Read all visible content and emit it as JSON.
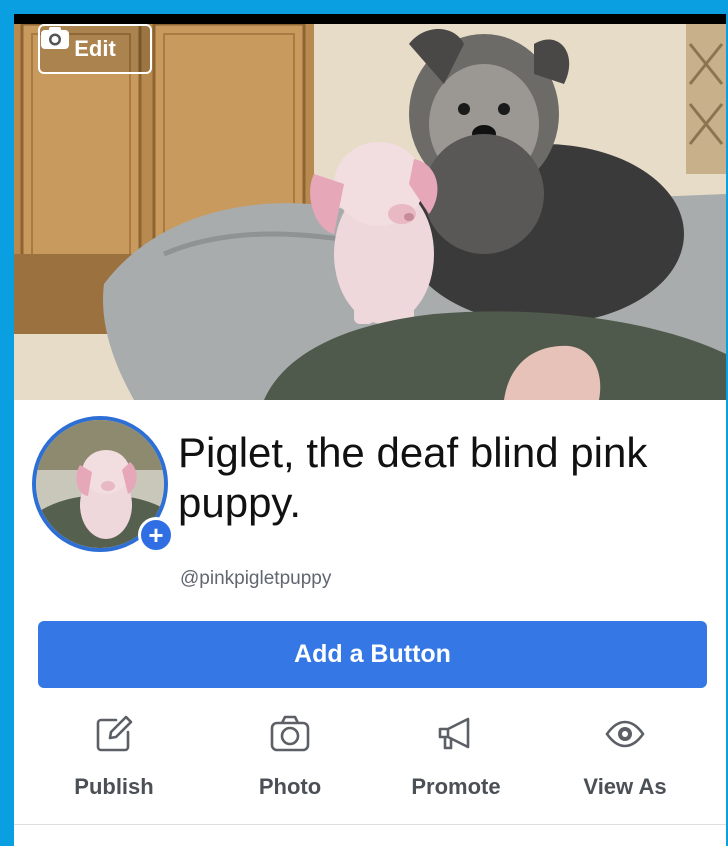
{
  "cover": {
    "edit_label": "Edit"
  },
  "profile": {
    "name": "Piglet, the deaf blind pink puppy.",
    "handle": "@pinkpigletpuppy",
    "add_button_label": "Add a Button"
  },
  "actions": [
    {
      "label": "Publish",
      "icon": "pencil-square-icon"
    },
    {
      "label": "Photo",
      "icon": "camera-icon"
    },
    {
      "label": "Promote",
      "icon": "megaphone-icon"
    },
    {
      "label": "View As",
      "icon": "eye-icon"
    }
  ],
  "colors": {
    "accent": "#3578e5",
    "frame": "#0a9fe0",
    "text": "#111111",
    "muted": "#606770",
    "action_text": "#4b4f56"
  }
}
